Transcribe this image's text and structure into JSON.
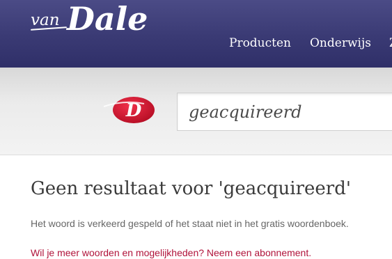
{
  "header": {
    "logo": {
      "van": "van",
      "dale": "Dale"
    },
    "nav": [
      {
        "label": "Producten"
      },
      {
        "label": "Onderwijs"
      },
      {
        "label": "Z"
      }
    ]
  },
  "search": {
    "value": "geacquireerd",
    "logo_letter": "D"
  },
  "result": {
    "title": "Geen resultaat voor 'geacquireerd'",
    "message": "Het woord is verkeerd gespeld of het staat niet in het gratis woordenboek.",
    "promo_link": "Wil je meer woorden en mogelijkheden? Neem een abonnement."
  },
  "colors": {
    "header_bg": "#3a3a74",
    "badge_red": "#d0112b",
    "promo_link": "#b0133a"
  }
}
